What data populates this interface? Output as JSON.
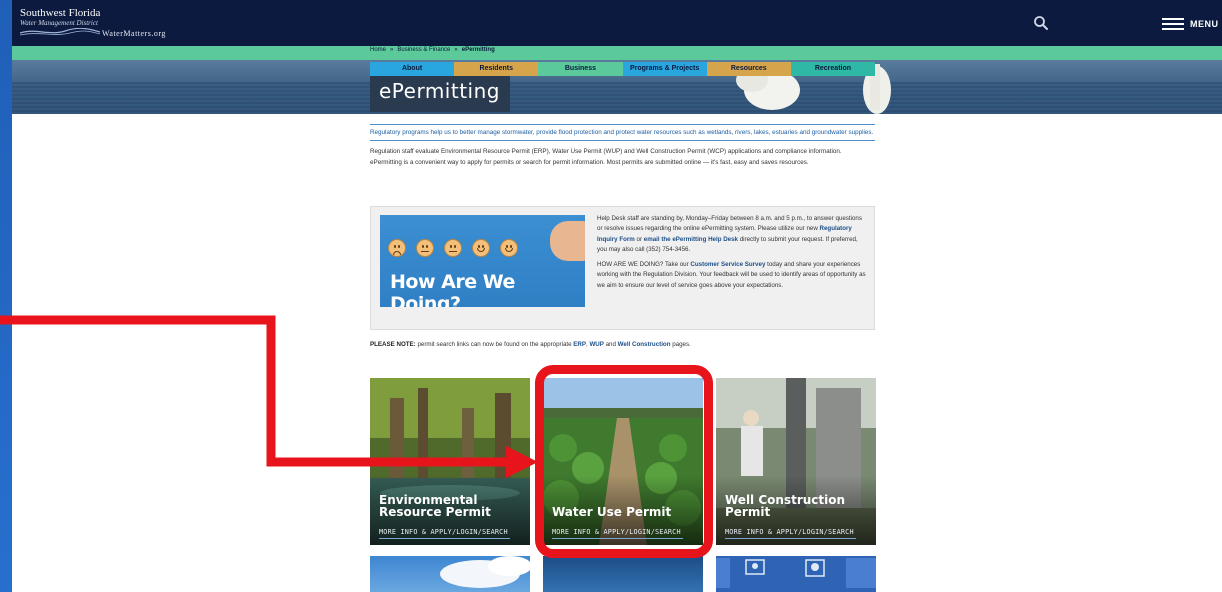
{
  "header": {
    "logo_line1": "Southwest Florida",
    "logo_line2": "Water Management District",
    "logo_site": "WaterMatters.org",
    "menu_label": "MENU",
    "search_icon": "search-icon",
    "menu_icon": "hamburger-icon"
  },
  "breadcrumb": {
    "items": [
      "Home",
      "Business & Finance",
      "ePermitting"
    ],
    "separator": "»"
  },
  "tabs": [
    {
      "label": "About",
      "color": "#2aa6de"
    },
    {
      "label": "Residents",
      "color": "#d6a54b"
    },
    {
      "label": "Business",
      "color": "#5cc99a"
    },
    {
      "label": "Programs & Projects",
      "color": "#2aa6de"
    },
    {
      "label": "Resources",
      "color": "#d6a54b"
    },
    {
      "label": "Recreation",
      "color": "#2fb8a6"
    }
  ],
  "page_title": "ePermitting",
  "intro": "Regulatory programs help us to better manage stormwater, provide flood protection and protect water resources such as wetlands, rivers, lakes, estuaries and groundwater supplies.",
  "paragraph": "Regulation staff evaluate Environmental Resource Permit (ERP), Water Use Permit (WUP) and Well Construction Permit (WCP) applications and compliance information. ePermitting is a convenient way to apply for permits or search for permit information. Most permits are submitted online — it's fast, easy and saves resources.",
  "helpbox": {
    "survey_title": "How Are We Doing?",
    "p1_a": "Help Desk staff are standing by, Monday–Friday between 8 a.m. and 5 p.m., to answer questions or resolve issues regarding the online ePermitting system. Please utilize our new ",
    "link_form": "Regulatory Inquiry Form",
    "p1_b": " or ",
    "link_email": "email the ePermitting Help Desk",
    "p1_c": " directly to submit your request. If preferred, you may also call (352) 754-3456.",
    "p2_a": "HOW ARE WE DOING? Take our ",
    "link_survey": "Customer Service Survey",
    "p2_b": " today and share your experiences working with the Regulation Division. Your feedback will be used to identify areas of opportunity as we aim to ensure our level of service goes above your expectations."
  },
  "note": {
    "label": "PLEASE NOTE:",
    "text_a": " permit search links can now be found on the appropriate ",
    "link_erp": "ERP",
    "text_b": ", ",
    "link_wup": "WUP",
    "text_c": " and ",
    "link_well": "Well Construction",
    "text_d": " pages."
  },
  "cards": [
    {
      "title": "Environmental Resource Permit",
      "link": "MORE INFO & APPLY/LOGIN/SEARCH"
    },
    {
      "title": "Water Use Permit",
      "link": "MORE INFO & APPLY/LOGIN/SEARCH"
    },
    {
      "title": "Well Construction Permit",
      "link": "MORE INFO & APPLY/LOGIN/SEARCH"
    }
  ],
  "colors": {
    "navy": "#0b1a3e",
    "green": "#5cc99a",
    "annotation_red": "#e8141c",
    "frame_blue": "#2a73d2"
  }
}
